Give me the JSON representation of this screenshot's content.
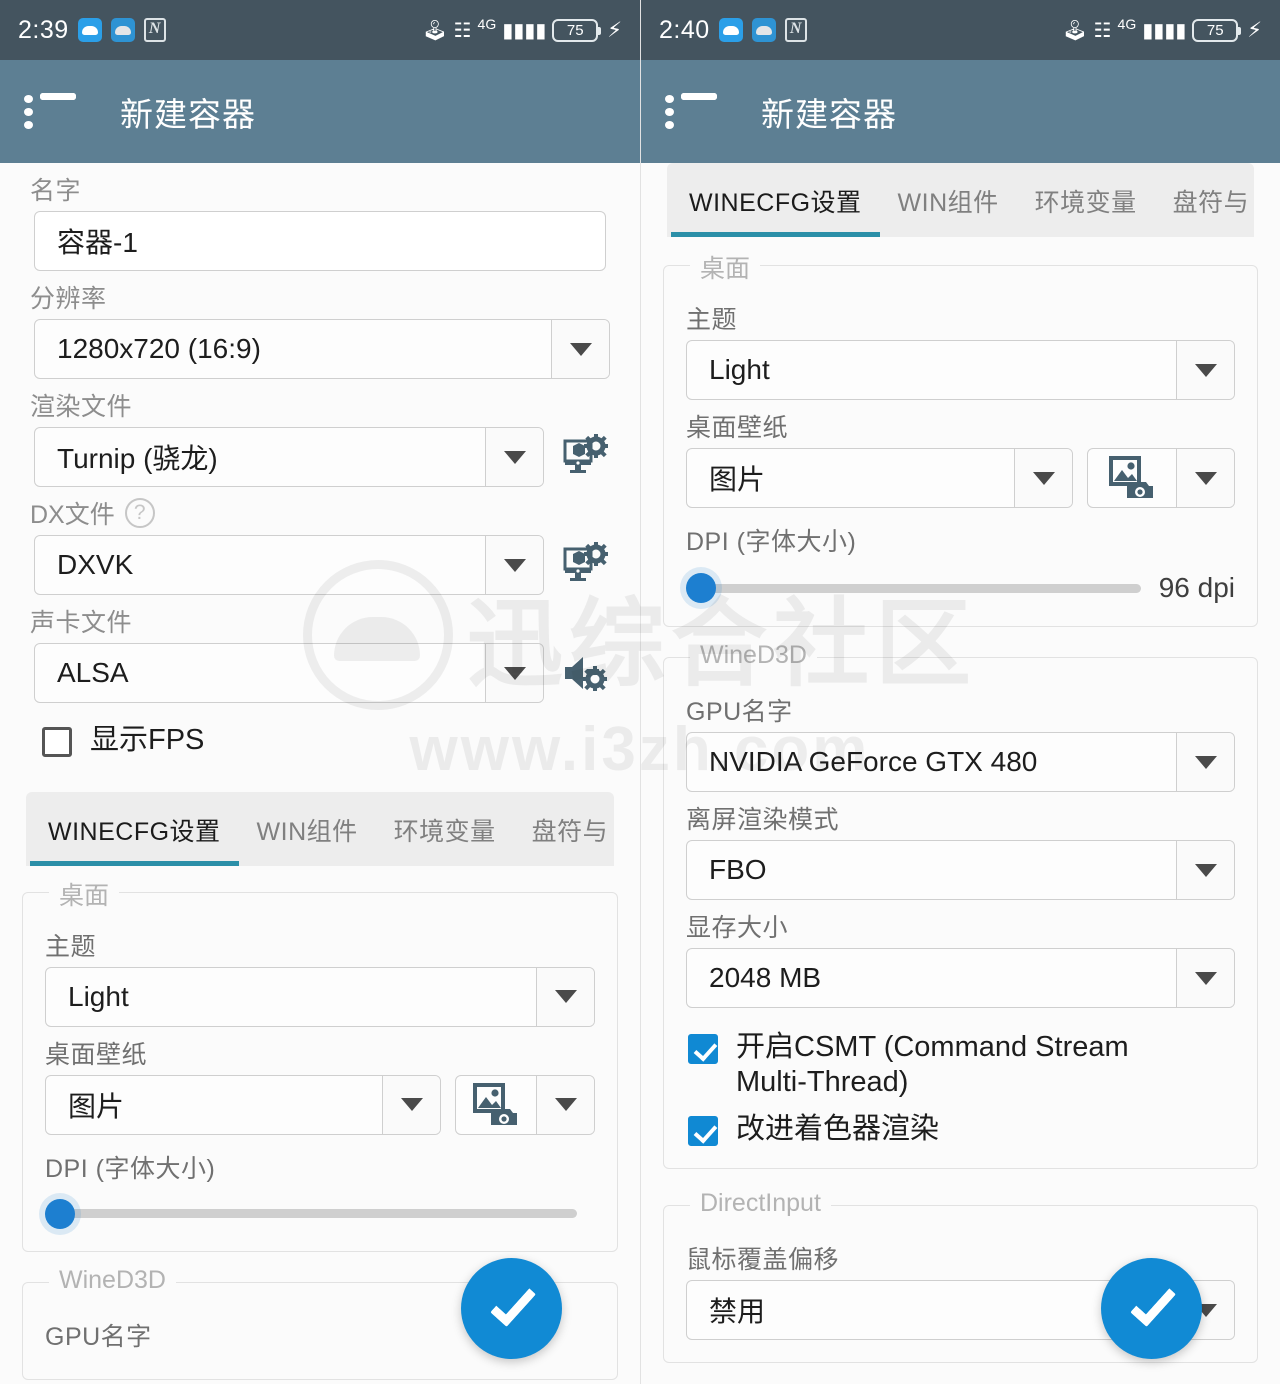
{
  "left": {
    "status": {
      "time": "2:39",
      "battery": "75",
      "network": "4G"
    },
    "appbar": {
      "title": "新建容器"
    },
    "fields": {
      "name_label": "名字",
      "name_value": "容器-1",
      "resolution_label": "分辨率",
      "resolution_value": "1280x720 (16:9)",
      "renderer_label": "渲染文件",
      "renderer_value": "Turnip (骁龙)",
      "dx_label": "DX文件",
      "dx_help": "?",
      "dx_value": "DXVK",
      "audio_label": "声卡文件",
      "audio_value": "ALSA",
      "show_fps_label": "显示FPS"
    },
    "tabs": [
      {
        "label": "WINECFG设置",
        "active": true
      },
      {
        "label": "WIN组件",
        "active": false
      },
      {
        "label": "环境变量",
        "active": false
      },
      {
        "label": "盘符与",
        "active": false
      }
    ],
    "desktop": {
      "group_title": "桌面",
      "theme_label": "主题",
      "theme_value": "Light",
      "wallpaper_label": "桌面壁纸",
      "wallpaper_value": "图片",
      "dpi_label": "DPI (字体大小)",
      "dpi_value": ""
    },
    "wined3d": {
      "group_title": "WineD3D",
      "gpu_label": "GPU名字"
    }
  },
  "right": {
    "status": {
      "time": "2:40",
      "battery": "75",
      "network": "4G"
    },
    "appbar": {
      "title": "新建容器"
    },
    "tabs": [
      {
        "label": "WINECFG设置",
        "active": true
      },
      {
        "label": "WIN组件",
        "active": false
      },
      {
        "label": "环境变量",
        "active": false
      },
      {
        "label": "盘符与",
        "active": false
      }
    ],
    "desktop": {
      "group_title": "桌面",
      "theme_label": "主题",
      "theme_value": "Light",
      "wallpaper_label": "桌面壁纸",
      "wallpaper_value": "图片",
      "dpi_label": "DPI (字体大小)",
      "dpi_value": "96 dpi"
    },
    "wined3d": {
      "group_title": "WineD3D",
      "gpu_label": "GPU名字",
      "gpu_value": "NVIDIA GeForce GTX 480",
      "offscreen_label": "离屏渲染模式",
      "offscreen_value": "FBO",
      "vram_label": "显存大小",
      "vram_value": "2048 MB",
      "csmt_label": "开启CSMT (Command Stream Multi-Thread)",
      "csmt_checked": true,
      "shader_label": "改进着色器渲染",
      "shader_checked": true
    },
    "directinput": {
      "group_title": "DirectInput",
      "mouse_label": "鼠标覆盖偏移",
      "mouse_value": "禁用"
    }
  },
  "watermark": {
    "text": "迅综合社区",
    "url": "www.i3zh.com"
  },
  "colors": {
    "statusbar": "#44545f",
    "appbar": "#5d7f93",
    "accent": "#118ad4",
    "tab_underline": "#2b8fa8",
    "page_bg": "#fbfbfb"
  }
}
